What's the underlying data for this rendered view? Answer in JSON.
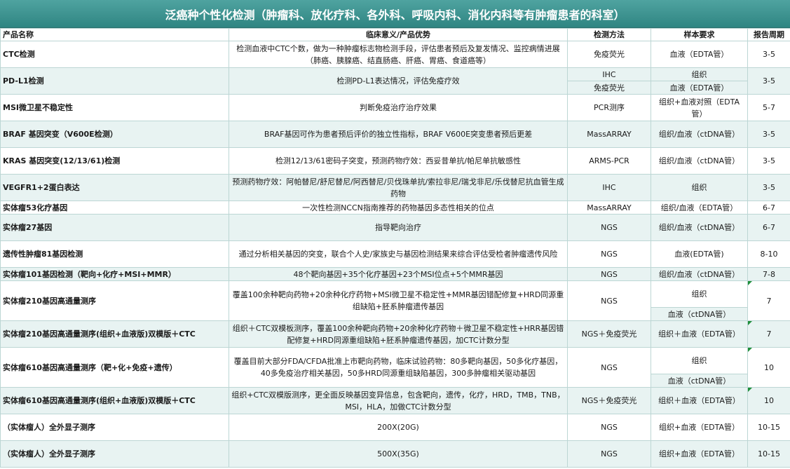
{
  "title": "泛癌种个性化检测（肿瘤科、放化疗科、各外科、呼吸内科、消化内科等有肿瘤患者的科室）",
  "headers": [
    "产品名称",
    "临床意义/产品优势",
    "检测方法",
    "样本要求",
    "报告周期"
  ],
  "rows": [
    {
      "name": "CTC检测",
      "meaning": "检测血液中CTC个数，做为一种肿瘤标志物检测手段，评估患者预后及复发情况、监控病情进展（肺癌、胰腺癌、结直肠癌、肝癌、胃癌、食道癌等）",
      "method": "免疫荧光",
      "sample": "血液（EDTA管）",
      "period": "3-5"
    },
    {
      "name": "PD-L1检测",
      "meaning": "检测PD-L1表达情况，评估免疫疗效",
      "method_a": "IHC",
      "method_b": "免疫荧光",
      "sample_a": "组织",
      "sample_b": "血液（EDTA管）",
      "period": "3-5"
    },
    {
      "name": "MSI微卫星不稳定性",
      "meaning": "判断免疫治疗治疗效果",
      "method": "PCR测序",
      "sample": "组织+血液对照（EDTA管）",
      "period": "5-7"
    },
    {
      "name": "BRAF 基因突变（V600E检测）",
      "meaning": "BRAF基因可作为患者预后评价的独立性指标，BRAF V600E突变患者预后更差",
      "method": "MassARRAY",
      "sample": "组织/血液（ctDNA管）",
      "period": "3-5"
    },
    {
      "name": "KRAS 基因突变(12/13/61)检测",
      "meaning": "检测12/13/61密码子突变，预测药物疗效：西妥昔单抗/帕尼单抗敏感性",
      "method": "ARMS-PCR",
      "sample": "组织/血液（ctDNA管）",
      "period": "3-5"
    },
    {
      "name": "VEGFR1+2蛋白表达",
      "meaning": "预测药物疗效：阿帕替尼/舒尼替尼/阿西替尼/贝伐珠单抗/索拉非尼/瑞戈非尼/乐伐替尼抗血管生成药物",
      "method": "IHC",
      "sample": "组织",
      "period": "3-5"
    },
    {
      "name": "实体瘤53化疗基因",
      "meaning": "一次性检测NCCN指南推荐的药物基因多态性相关的位点",
      "method": "MassARRAY",
      "sample": "组织/血液（EDTA管）",
      "period": "6-7"
    },
    {
      "name": "实体瘤27基因",
      "meaning": "指导靶向治疗",
      "method": "NGS",
      "sample": "组织/血液（ctDNA管）",
      "period": "6-7"
    },
    {
      "name": "遗传性肿瘤81基因检测",
      "meaning": "通过分析相关基因的突变，联合个人史/家族史与基因检测结果来综合评估受检者肿瘤遗传风险",
      "method": "NGS",
      "sample": "血液(EDTA管)",
      "period": "8-10"
    },
    {
      "name": "实体瘤101基因检测（靶向+化疗+MSI+MMR）",
      "meaning": "48个靶向基因+35个化疗基因+23个MSI位点+5个MMR基因",
      "method": "NGS",
      "sample": "组织/血液（ctDNA管）",
      "period": "7-8"
    },
    {
      "name": "实体瘤210基因高通量测序",
      "meaning": "覆盖100余种靶向药物+20余种化疗药物+MSI微卫星不稳定性+MMR基因错配修复+HRD同源重组缺陷+胚系肿瘤遗传基因",
      "method": "NGS",
      "sample_a": "组织",
      "sample_b": "血液（ctDNA管）",
      "period": "7"
    },
    {
      "name": "实体瘤210基因高通量测序(组织+血液版)双模版＋CTC",
      "meaning": "组织＋CTC双模板测序，覆盖100余种靶向药物+20余种化疗药物＋微卫星不稳定性+HRR基因错配修复+HRD同源重组缺陷+胚系肿瘤遗传基因，加CTC计数分型",
      "method": "NGS＋免疫荧光",
      "sample": "组织＋血液（EDTA管）",
      "period": "7"
    },
    {
      "name": "实体瘤610基因高通量测序（靶+化+免疫+遗传）",
      "meaning": "覆盖目前大部分FDA/CFDA批准上市靶向药物，临床试验药物：80多靶向基因，50多化疗基因，40多免疫治疗相关基因，50多HRD同源重组缺陷基因，300多肿瘤相关驱动基因",
      "method": "NGS",
      "sample_a": "组织",
      "sample_b": "血液（ctDNA管）",
      "period": "10"
    },
    {
      "name": "实体瘤610基因高通量测序(组织+血液版)双模版＋CTC",
      "meaning": "组织+CTC双模版测序，更全面反映基因变异信息，包含靶向，遗传，化疗，HRD，TMB，TNB，MSI，HLA，加做CTC计数分型",
      "method": "NGS＋免疫荧光",
      "sample": "组织＋血液（EDTA管）",
      "period": "10"
    },
    {
      "name": "（实体瘤人）全外显子测序",
      "meaning": "200X(20G)",
      "method": "NGS",
      "sample": "组织+血液（EDTA管）",
      "period": "10-15"
    },
    {
      "name": "（实体瘤人）全外显子测序",
      "meaning": "500X(35G)",
      "method": "NGS",
      "sample": "组织+血液（EDTA管）",
      "period": "10-15"
    }
  ],
  "colors": {
    "title_bg": "#2f8582",
    "row_alt": "#e8f3f2",
    "border": "#bcd6d4",
    "comment_flag": "#1f8f3a"
  }
}
